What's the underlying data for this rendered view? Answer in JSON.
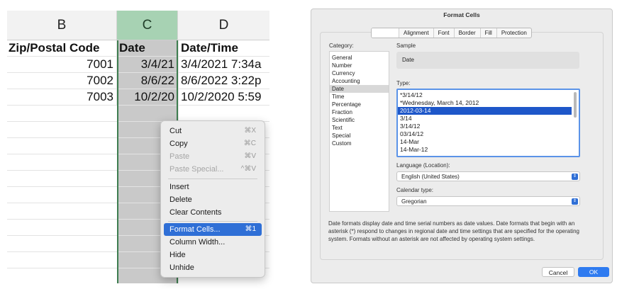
{
  "sheet": {
    "columns": [
      "B",
      "C",
      "D"
    ],
    "headers": [
      "Zip/Postal Code",
      "Date",
      "Date/Time"
    ],
    "rows": [
      [
        "7001",
        "3/4/21",
        "3/4/2021 7:34a"
      ],
      [
        "7002",
        "8/6/22",
        "8/6/2022 3:22p"
      ],
      [
        "7003",
        "10/2/20",
        "10/2/2020 5:59"
      ]
    ]
  },
  "context_menu": {
    "items": [
      {
        "label": "Cut",
        "shortcut": "⌘X"
      },
      {
        "label": "Copy",
        "shortcut": "⌘C"
      },
      {
        "label": "Paste",
        "shortcut": "⌘V"
      },
      {
        "label": "Paste Special...",
        "shortcut": "^⌘V"
      },
      {
        "label": "Insert",
        "shortcut": ""
      },
      {
        "label": "Delete",
        "shortcut": ""
      },
      {
        "label": "Clear Contents",
        "shortcut": ""
      },
      {
        "label": "Format Cells...",
        "shortcut": "⌘1"
      },
      {
        "label": "Column Width...",
        "shortcut": ""
      },
      {
        "label": "Hide",
        "shortcut": ""
      },
      {
        "label": "Unhide",
        "shortcut": ""
      }
    ]
  },
  "dialog": {
    "title": "Format Cells",
    "tabs": [
      "",
      "Alignment",
      "Font",
      "Border",
      "Fill",
      "Protection"
    ],
    "category_label": "Category:",
    "categories": [
      "General",
      "Number",
      "Currency",
      "Accounting",
      "Date",
      "Time",
      "Percentage",
      "Fraction",
      "Scientific",
      "Text",
      "Special",
      "Custom"
    ],
    "sample_label": "Sample",
    "sample_value": "Date",
    "type_label": "Type:",
    "types": [
      "*3/14/12",
      "*Wednesday, March 14, 2012",
      "2012-03-14",
      "3/14",
      "3/14/12",
      "03/14/12",
      "14-Mar",
      "14-Mar-12"
    ],
    "language_label": "Language (Location):",
    "language_value": "English (United States)",
    "calendar_label": "Calendar type:",
    "calendar_value": "Gregorian",
    "description": "Date formats display date and time serial numbers as date values.  Date formats that begin with an asterisk (*) respond to changes in regional date and time settings that are specified for the operating system. Formats without an asterisk are not affected by operating system settings.",
    "cancel_label": "Cancel",
    "ok_label": "OK"
  },
  "colors": {
    "selected_column_header": "#a7d2b3",
    "selected_column": "#c9c9c9",
    "menu_highlight": "#2f6fd6",
    "type_selection": "#1e57c9",
    "ok_button": "#2f7bf0"
  }
}
